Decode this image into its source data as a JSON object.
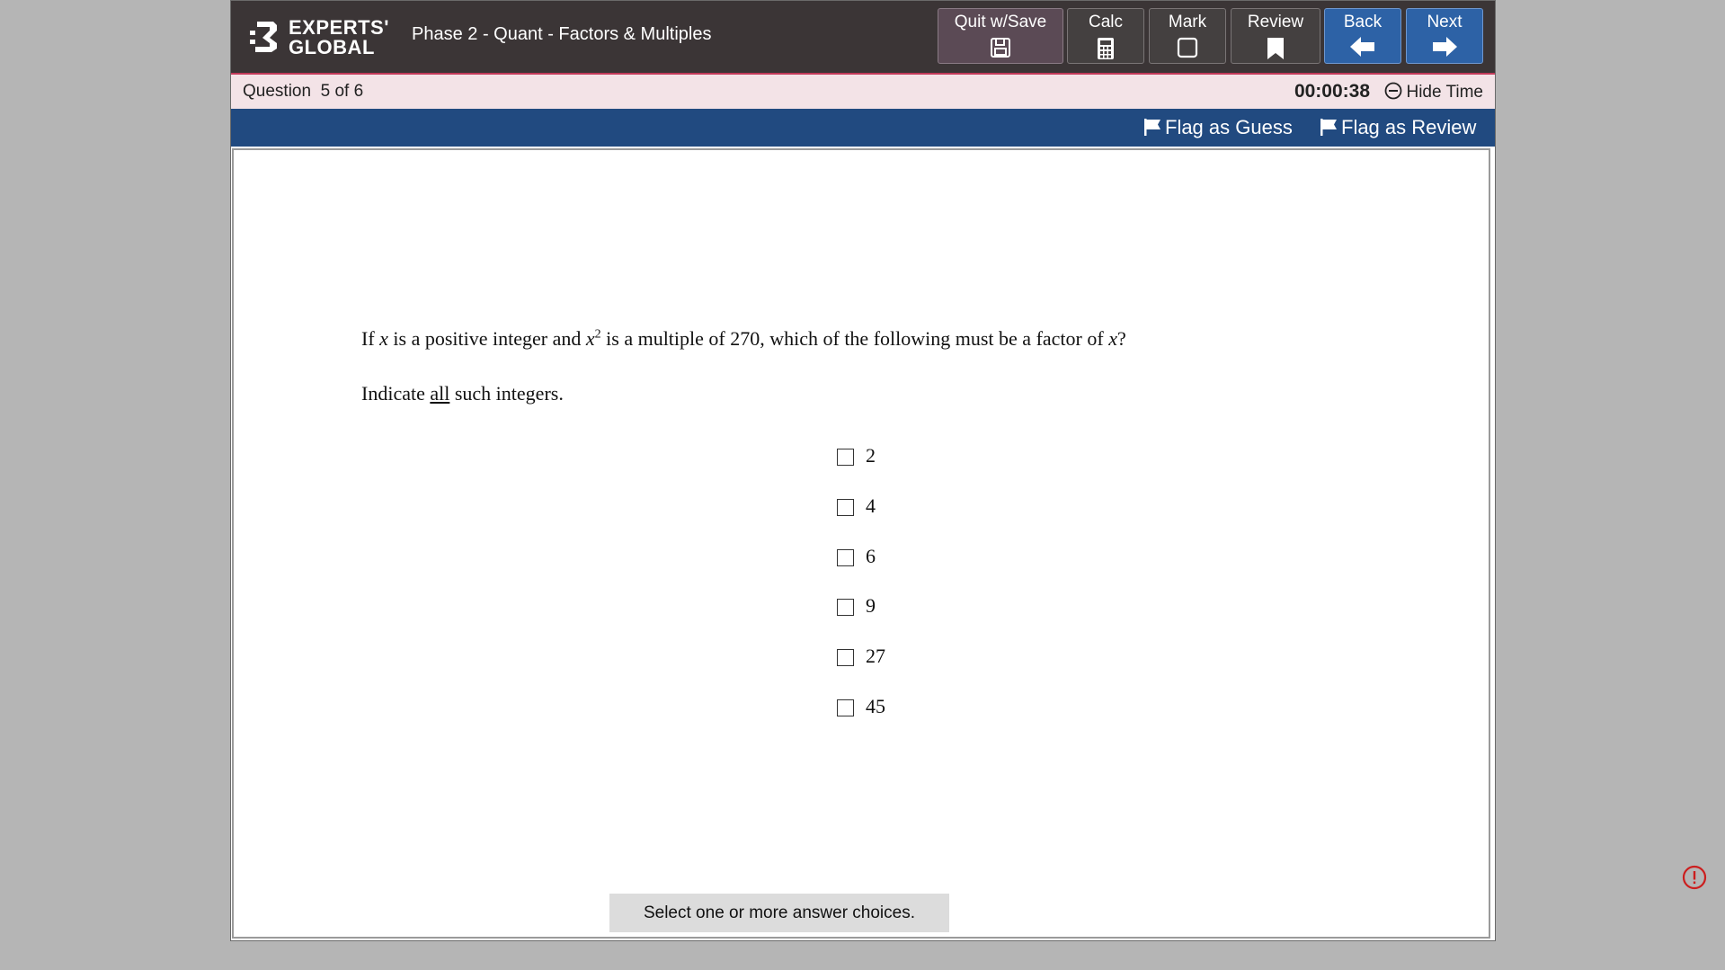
{
  "brand": {
    "line1": "EXPERTS'",
    "line2": "GLOBAL"
  },
  "test_title": "Phase 2 - Quant - Factors & Multiples",
  "toolbar": {
    "quit_label": "Quit w/Save",
    "calc_label": "Calc",
    "mark_label": "Mark",
    "review_label": "Review",
    "back_label": "Back",
    "next_label": "Next"
  },
  "status": {
    "question_counter": "Question  5 of 6",
    "timer": "00:00:38",
    "hide_time_label": "Hide Time"
  },
  "flags": {
    "guess_label": "Flag as Guess",
    "review_label": "Flag as Review"
  },
  "question": {
    "stem_parts": {
      "p1": "If ",
      "x": "x",
      "p2": " is a positive integer and ",
      "sup": "2",
      "p3": " is a multiple of 270, which of the following must be a factor of ",
      "p4": "?"
    },
    "instruction_parts": {
      "pre": "Indicate ",
      "emph": "all",
      "post": " such integers."
    },
    "choices": [
      "2",
      "4",
      "6",
      "9",
      "27",
      "45"
    ],
    "prompt": "Select one or more answer choices."
  },
  "colors": {
    "topbar": "#3b3536",
    "nav_button": "#2d62a6",
    "flag_bar": "#214a80",
    "question_bar": "#f3e3e7",
    "alert": "#cc1e1e"
  },
  "icons": [
    "save-icon",
    "calculator-icon",
    "mark-checkbox-icon",
    "bookmark-icon",
    "arrow-left-icon",
    "arrow-right-icon",
    "minus-circle-icon",
    "flag-icon",
    "alert-icon"
  ]
}
